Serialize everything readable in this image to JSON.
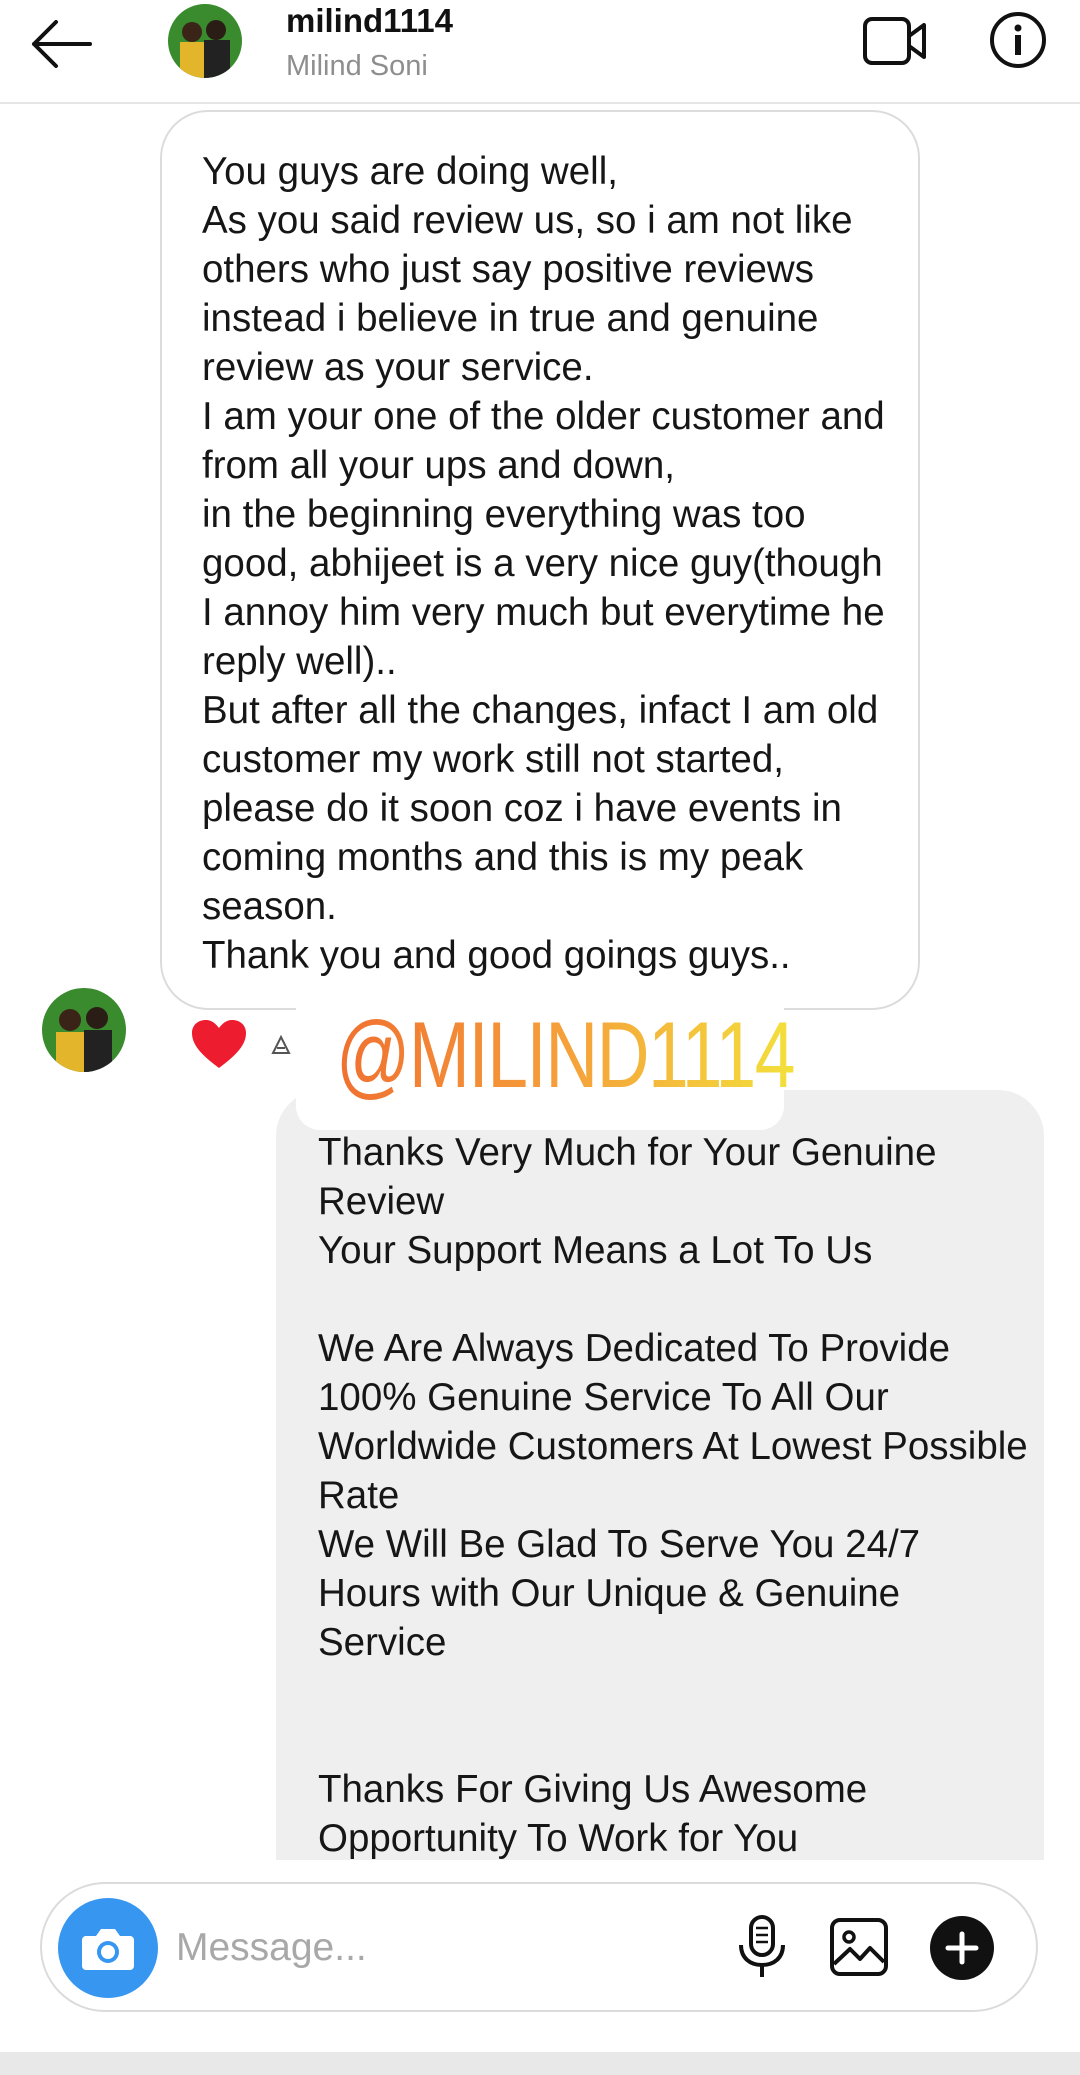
{
  "header": {
    "username": "milind1114",
    "full_name": "Milind Soni",
    "icons": [
      "back-arrow-icon",
      "video-call-icon",
      "info-icon"
    ]
  },
  "messages": [
    {
      "direction": "incoming",
      "text": "You guys are doing well,\nAs you said review us, so i am not like others who just say positive reviews instead i believe in true and genuine review as your service.\nI am your one of the older customer and from all your ups and down,\nin the beginning everything was too good, abhijeet is a very nice guy(though I annoy him very much but everytime he reply well)..\nBut after all the changes, infact I am old customer my work still not started, please do it soon coz i have events in coming months and this is my peak season.\nThank you and good goings guys..",
      "reaction": "heart-icon"
    },
    {
      "direction": "outgoing",
      "text": "Thanks Very Much for Your Genuine Review\nYour Support Means a Lot To Us\n\nWe Are Always Dedicated To Provide 100% Genuine Service To All Our Worldwide Customers At Lowest Possible Rate\nWe Will Be Glad To Serve You 24/7 Hours with Our Unique & Genuine Service\n\n\nThanks For Giving Us Awesome Opportunity To Work for You"
    }
  ],
  "sticker": {
    "text": "@MILIND1114",
    "colors": [
      "#f07030",
      "#f5a03a",
      "#f3e03c"
    ]
  },
  "composer": {
    "placeholder": "Message...",
    "value": "",
    "icons": [
      "camera-icon",
      "microphone-icon",
      "gallery-icon",
      "plus-icon"
    ]
  },
  "colors": {
    "accent": "#3797f0",
    "heart": "#ed1c2e",
    "outgoing_bubble": "#efefef"
  }
}
